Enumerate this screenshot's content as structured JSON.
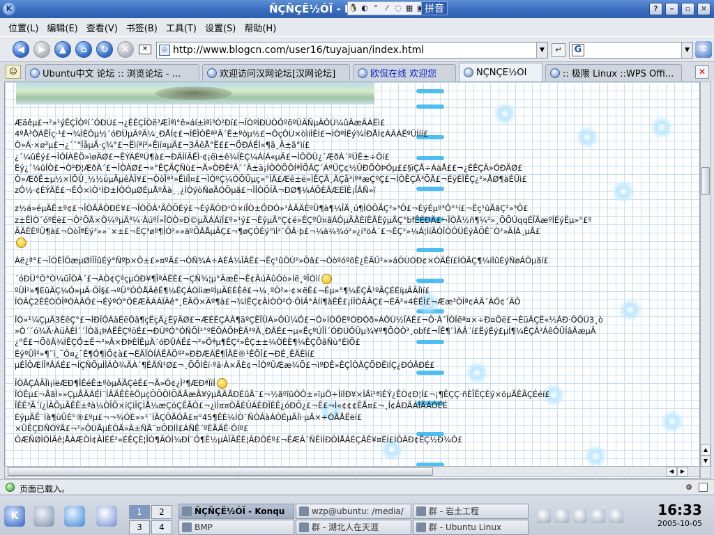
{
  "window": {
    "title": "ÑÇÑÇË½ÓÏ - Ko",
    "ime_label": "拼音",
    "help_label": "?",
    "minimize_label": "–",
    "maximize_label": "▫",
    "close_label": "✕"
  },
  "menubar": {
    "items": [
      "位置(L)",
      "编辑(E)",
      "查看(V)",
      "书签(B)",
      "工具(T)",
      "设置(S)",
      "帮助(H)"
    ]
  },
  "toolbar": {
    "url": "http://www.blogcn.com/user16/tuyajuan/index.html",
    "search_engine": "G"
  },
  "tabs": [
    {
      "label": "Ubuntu中文 论坛 :: 浏览论坛 - ...",
      "active": false
    },
    {
      "label": "欢迎访问汉网论坛[汉网论坛]",
      "active": false
    },
    {
      "label": "欧侃在线 欢迎您",
      "active": false,
      "color": "#0a23c8"
    },
    {
      "label": "ÑÇÑÇË½ÓÏ",
      "active": true
    },
    {
      "label": ":: 极限 Linux ::WPS Offi...",
      "active": false
    }
  ],
  "content": {
    "paragraphs": [
      [
        "Æäêµ£¬²»¹ýÊÇÎÒºí´ÓÐÚ£¬¿ÉÊÇÎÒë³ÆÎªì°ê»áí±ìªì³Ó²Ðí£¬ÎÒºÍÐÙÒÔºöºÜÄÑµÄÔÙ¼ûÃæÄÁËì£",
        "4ºÅ³ÔÁÊÎç·¹£¬¾ÍÈÕµ½´óÐÜµÄºÃ¼¸ÐÅÍ¢£¬ÍÊÎÒÊª²Ã´Ê±ºòµ½£¬ÔçÔÚ×òìíÍÉÍ£¬ÍÒºÍÉý¾ÍÐÅÍ¢ÁÄÁËºÜÍíí£",
        "Ò»Á·×ø³µ£¬¿´¨°ÍåµÄ·ç¾°£¬Ëìíªí²»Ëìí¤µÄ£¬3ÁêÅ°Ë££¬ÕÐÁÉÍ«¶ã¸Ä±ã°ìí£",
        "¿´¼ûÉý£¬ÎÒÍÀÊÕ»ìøÄØ£¬ËÝÁÉºÙ¶à£¬ÐÄÍÍÄËÌ·¢¡ëì±ê¾ÍÈÇ¼ÁíÁ«µÄ£¬ÌÕÖÚ¿´ÆðÀ´ºÜÊ±÷Õí£",
        "Èý¿´¼ûÍÒ£¬Ò²Ð¦ÆðÀ´£¬ÎÒÀØ£¬»°ÊÇÃÇÑù£¬Ã»ÓÐÊ²Ã´´Ä±ä¡ÍÒÒÕÔÍªÏÕÃÇ´ÁºÜÇ¢½ÛÐÕÒÞÓµ££§ïÇÅ÷ÁàÅ££¬¿ÉÊÇÃ»ÓÐÄØ£",
        "Ò»ÆðÊ±µ½×ÌÔÚ¸½½üµÄµêÀÌ¥£¬ÒòÎª²»ÊìíÌ¤£¬ÌÒºÇ¼ÓÔÛµç»°ÌÃ£Æê±ë»ÌÊÇÃ¸ÃÇå³íºªæÇºÇ£¬ÍÒÊÇÃ³ÕÃ£¬ÉÿÈÏÊÇ¿²»ÅØ¶àÉÜì£",
        "zÔ½·¢ÉÝÄÉ£¬ÊÔ×ìÒ¹ÌÐ±ÍÒÓµØÉµÅºÃà¸¸¿ÍÒýòÑøÂÓÕµã£¬ÏÍÒÕÍÄ¬ÐØ¶¼ÁÕÈÃÆÉÏÉ¡ÏÂÑ»ï"
      ],
      [
        "z½á»éµÄÊ±º¢£¬ÎÒÃÂÓÐÈ¥£¬ÎÒÕÀ¹ÂÔÕÉý£¬ÉýÃÓÐ¹Ò×íÎÒ±ÖÐÓ»¹ÁÄÄÈºÜ¶à¶¼ÎÃ¸ú¶ÌÓÔÃÇ²»³Ô£¬ÉýÉµº³Ô°¹í£¬Ëç¹ûÃãÇ²»³Ô£",
        "z±ÊÌÒ´óºÉë£¬Ò²ÕÃ×Ò¼ºµÄ³¼·ÀúºÍ»ÎÒÒ»Ð©µÄÁÁïÍ£º»¹ý£¬ÈýµÄ°Ç¢é»ÊÇºÜ¤ãÁÓµÄÃÈíÊÃÈýµÃÇ°bfÊÈÐÃ£¬ÏÒÂ½ñ¶¼²»¸ÕÕÙqqÉÏÃæºÍÉýËµ»°£º",
        "ÄÄÊÊºÜ¶à£¬ÒòÎªÉý²»»¨×±£¬ËÇ³øº¶ÌÓ²»»äºÕÃÅµÄÇ£¬¶øÇÓÉý°ìÍ²¯ÔÂ·þ£¬¼ä¼¾ó²»¿í³öÀ´£¬ÊÇ²»¼Á¦ÌíÃÒÎÒÔÜÉýÃÕÊ¯Ò²»ÄÍÀ¸µÃ£"
      ],
      [
        "Àë¿ª°£¬ÎÒÈÎÕæµØÍÎÎûÉý°Ñºþ×Ô±£»¤ºÃ£¬ÒÑ¾­Á÷ÀÉÁ¼ÎÀÊ£¬Ëç¹ûÔÙ²»Õâ£¬ÒòºóºöÈ¿ÈÃÜ²»»áÕÙÓÐ¢×ÓÄÊí£ÍÒÃÇ¶¼íÍûÉýÑøÁÕµãí£"
      ],
      [
        "´óÐÜ°Ô°Ò¼üÎÒÀ´£¬ÀÒ¢ÇºçµÓÐ¥¶ÎªÁËÈ­£¬ÇÑ¾¦µ°ÃæÊ¬Ê¢ÂúÂûÕò»Íë¸ºÎÒìí",
        "ºÜÌ²»¶ÈüÃÇ¼Ó»µÄ·ÕÎ§£¬ºÜ°ÕÔÅÃêÊ¶¼ÊÇÀÒÌìæºÍµÄÈÉÉê£¬¼¸ºÕ²»·¢×ëÊ£¬Ëµ»°¶¼ÊÇÃ¹ºÃÇÉÈíµÄÄÌìí£",
        "ÎÒÃÇ2ÈÉÒÔÎªÒÀÄÕ£¬ÉýºÓ°ÔÈÆÃÀÀÏÄê°¸ÈÃÕ×Ãº¶à£¬¾ÍÊÇ¢ÃÌÒÔ²Ó·ÕÍÄ°ÁÍí¶àÊÊ£¡ÍÎÒÃÃÇ£¬ÈÃ²»4ÈËÌ£¬Ææ³ÕÍª¢ÁÄ´ÁÕ¢´ÃÔ"
      ],
      [
        "ÎÒ»¹¼ÇµÃ3ÈêÇ°£¬ÍÐÏÔÁàÈëÔâ¶çËçÃ¿ÈÿÄØ£¬ÆÉÈÇÃÀ¶äºÇÊÏÜÁ»ÔÛ¼Ö£¬Ö»ÍÒÕÈºÓÐÓð»ÁÔÙ½ÏÁÉ£¬Ô·À´ÎÒÍêª¤×÷Ð¤Õë£¬ÈüÃÇË«½ÁÐ·ÔÕÙ3¸ò",
        "»Ò´´ó¾Ä·ÀüÄÈÍ´´ÎÒã¡ÞÁËÊÇºöÉ£¬ÐÙºÓ°ÓÑÕÍ¹°ºÈÕÀÕÞÈÃ²ºÃ¸ÐÃÉ£¬µ«ËçºÚÎÍ´ÓÐÚÔÛµ¾¥º¶ÕÒÒ³¸obf£¬ÎÊ¶¨ÌÀÂ¨í£ËýÉý£µÍ¶¼ÊÇÃ³ÁêÔÛÍâÃæµÄ",
        "¿°É£¬ÕõÂ¾ÍÊÇÖ±Ë¬²»Â×ÐÞÈÍÊµÄ´óÐÜÁË£¬²»Öªµ¶ÊÇ²»ÊÇ±±¼ÒÈÈ¶¼ÊÇÕâÑù°ÉìÕ£",
        "ÉýºÜÌ²»¶¨ì¸¯Ó¤¿¯È¶Ó¶ìÕ¢à£¬ÈÃÎÒÍÁËÂÕº²»ÐÐÆÀË¶ÎÂÈ®¹ÊÕÎ£¬ÐÉ¸ÊÄÈìí£",
        "µÉÎÒÆÍÎªÂÁÉ£¬ÍÇÑÕµÌÌÁÒ¾ÄÀ´¶ÉÃÑ¹Ø£¬¸ÕÕÌÈí·ºâ·À×ÄÈ¢¬ÎÒºÜÆæ¾Õ£¬ìºÐÊ»ÊÇÎÒÃÇÕÐËìÍÇ¿ÐÓÃÐÉ£"
      ],
      [
        "ÎÒÃÇÁÄÌì¡ìëÆÐ¶ÌÊéÊ±ºòµÄÃÇêÉ£¬Ã»Ó¢¿Ì²¶ÆÐªÏíÍ",
        "ÎÒÊµ£¬ÃãÌ»»ÇµÃÄÄÉÌ¨ÍÂÄÊÈêÖµçÕÕÔÌÕÄÃæÂ¥ýµÃÄÃÐÉûÃ¨£¬½ãºîûÒÔ±»ïµÖ÷ÌíÍÐ¥×ÌÄì¹ªìÉÝ¿ÊÒ¢Ð¦Í£¬¡¶ÊÇÇ·ñÈÏÊÇÉý×öµÃÊÂÇÉéí£",
        "ÎÊÊ³Ã´í¿ÌÀÔµÃÊÊ±ªà¼ÒÎÔ×íÇìÏÇÌÅ¼æÇóÇÊÃÓ£¬¿ìÍ¤¤ÒÂÉÚÁÉÐÏÈÊ¿óÐÕ¿£¬Ê£¬Ì«¢¢¢ÊÅ¤£¬¸Í¢ÁÐÃÁÍÄÁÒÉÉ",
        "ÉýµÄÊ¨Ìà¶ùÜÉ°®£ºµ£¬¬¾ÓÈ»»¹´ÍÃÇÔÃÓÃ£¤°45¶ÊÈ¼ÍÒ¯ÑÓÁàÁÓÉµÄÍì·µÃ×÷ÓÃÅËëí£",
        "×ÜÊÇÐÑÓÝÃ£¬²»ÔÚÃµÈÔÃ»Á±ÑÃ¨¤ÕÐÌÌ£ÁÑÊ´ºËÃÄÊ·Ôíº£",
        "ÔÆÑØÌÓÍÃê¦ÅÀÆÔÌ¢ÂÌÉÉ²»ÉÊÇÈ¦ÎÓ¶ÃÓÍ¾ÐÍ¨Ô¶Ê½µÁÏÃÊÈ¦ÂÐÔÉº£¬ËÆÂ´ÑÊÌÍÐÔÌÅÁÉÇÃÊ¥¤ËÍ£ÍÔÂÐ¢ÊÇ½Ð¾Ô£"
      ]
    ]
  },
  "status": {
    "text": "页面已载入。"
  },
  "taskbar": {
    "kmenu_label": "K",
    "pager": [
      "1",
      "2",
      "3",
      "4"
    ],
    "active_desktop": "1",
    "tasks": [
      {
        "label": "ÑÇÑÇË½ÓÏ - Konqu",
        "active": true
      },
      {
        "label": "wzp@ubuntu: /media/",
        "active": false
      },
      {
        "label": "群 - 岩土工程",
        "active": false
      },
      {
        "label": "BMP",
        "active": false
      },
      {
        "label": "群 - 湖北人在天涯",
        "active": false
      },
      {
        "label": "群 - Ubuntu Linux",
        "active": false
      }
    ],
    "clock_time": "16:33",
    "clock_date": "2005-10-05"
  },
  "icons": {
    "back": "back-arrow-icon",
    "forward": "forward-arrow-icon",
    "up": "up-arrow-icon",
    "home": "home-icon",
    "reload": "reload-icon",
    "stop": "stop-icon",
    "clear": "clear-location-icon",
    "go": "go-icon",
    "konqueror": "konqueror-logo-icon"
  },
  "colors": {
    "titlebar": "#3a6cc0",
    "link_blue": "#0a23c8",
    "grid_line": "#c9dff2",
    "spiral": "#3ab8ef"
  }
}
